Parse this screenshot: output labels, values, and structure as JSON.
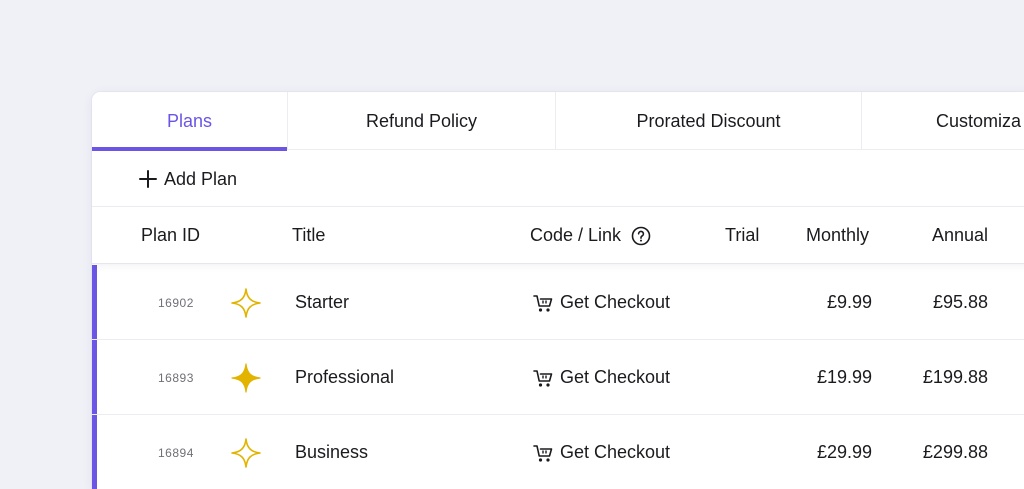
{
  "tabs": [
    {
      "label": "Plans",
      "active": true
    },
    {
      "label": "Refund Policy",
      "active": false
    },
    {
      "label": "Prorated Discount",
      "active": false
    },
    {
      "label": "Customiza",
      "active": false
    }
  ],
  "toolbar": {
    "add_plan_label": "Add Plan",
    "add_icon": "plus-icon"
  },
  "table": {
    "columns": [
      "Plan ID",
      "Title",
      "Code / Link",
      "Trial",
      "Monthly",
      "Annual"
    ],
    "code_help_icon": "question-circle-icon",
    "rows": [
      {
        "id": "16902",
        "star_icon": "sparkle-outline-icon",
        "title": "Starter",
        "checkout": "Get Checkout",
        "trial": "",
        "monthly": "£9.99",
        "annual": "£95.88"
      },
      {
        "id": "16893",
        "star_icon": "sparkle-filled-icon",
        "title": "Professional",
        "checkout": "Get Checkout",
        "trial": "",
        "monthly": "£19.99",
        "annual": "£199.88"
      },
      {
        "id": "16894",
        "star_icon": "sparkle-outline-icon",
        "title": "Business",
        "checkout": "Get Checkout",
        "trial": "",
        "monthly": "£29.99",
        "annual": "£299.88"
      }
    ]
  },
  "colors": {
    "accent": "#6a55e6",
    "star": "#e2b400",
    "background": "#f0f0f7"
  }
}
